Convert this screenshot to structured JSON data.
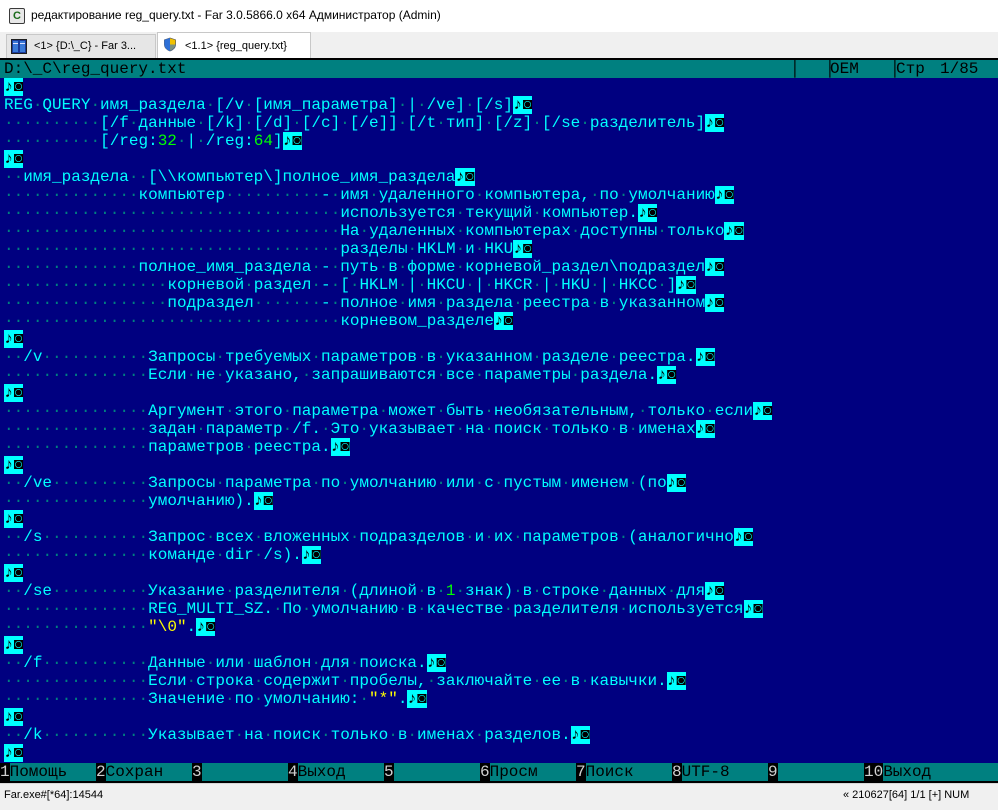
{
  "window": {
    "title": "редактирование reg_query.txt - Far 3.0.5866.0 x64 Администратор (Admin)",
    "icon": "far-manager-icon"
  },
  "tabs": [
    {
      "label": "<1> {D:\\_C} - Far 3...",
      "icon": "far-panels-icon",
      "active": false
    },
    {
      "label": "<1.1> {reg_query.txt}",
      "icon": "shield-icon",
      "active": true
    }
  ],
  "editor": {
    "path": "D:\\_C\\reg_query.txt",
    "codepage": "OEM",
    "mode_label": "Стр",
    "position": "1/85",
    "lines": [
      "",
      "REG QUERY имя_раздела [/v [имя_параметра] | /ve] [/s]",
      "          [/f данные [/k] [/d] [/c] [/e]] [/t тип] [/z] [/se разделитель]",
      "          [/reg:32 | /reg:64]",
      "",
      "  имя_раздела  [\\\\компьютер\\]полное_имя_раздела",
      "              компьютер          - имя удаленного компьютера, по умолчанию",
      "                                   используется текущий компьютер.",
      "                                   На удаленных компьютерах доступны только",
      "                                   разделы HKLM и HKU",
      "              полное_имя_раздела - путь в форме корневой_раздел\\подраздел",
      "                 корневой раздел - [ HKLM | HKCU | HKCR | HKU | HKCC ]",
      "                 подраздел       - полное имя раздела реестра в указанном",
      "                                   корневом_разделе",
      "",
      "  /v           Запросы требуемых параметров в указанном разделе реестра.",
      "               Если не указано, запрашиваются все параметры раздела.",
      "",
      "               Аргумент этого параметра может быть необязательным, только если",
      "               задан параметр /f. Это указывает на поиск только в именах",
      "               параметров реестра.",
      "",
      "  /ve          Запросы параметра по умолчанию или с пустым именем (по",
      "               умолчанию).",
      "",
      "  /s           Запрос всех вложенных подразделов и их параметров (аналогично",
      "               команде dir /s).",
      "",
      "  /se          Указание разделителя (длиной в 1 знак) в строке данных для",
      "               REG_MULTI_SZ. По умолчанию в качестве разделителя используется",
      "               \"\\0\".",
      "",
      "  /f           Данные или шаблон для поиска.",
      "               Если строка содержит пробелы, заключайте ее в кавычки.",
      "               Значение по умолчанию: \"*\".",
      "",
      "  /k           Указывает на поиск только в именах разделов.",
      ""
    ]
  },
  "keybar": [
    {
      "num": "1",
      "label": "Помощь"
    },
    {
      "num": "2",
      "label": "Сохран"
    },
    {
      "num": "3",
      "label": ""
    },
    {
      "num": "4",
      "label": "Выход"
    },
    {
      "num": "5",
      "label": ""
    },
    {
      "num": "6",
      "label": "Просм"
    },
    {
      "num": "7",
      "label": "Поиск"
    },
    {
      "num": "8",
      "label": "UTF-8"
    },
    {
      "num": "9",
      "label": ""
    },
    {
      "num": "10",
      "label": "Выход"
    }
  ],
  "statusbar": {
    "left": "Far.exe#[*64]:14544",
    "right": "« 210627[64]   1/1   [+] NUM"
  },
  "colors": {
    "background": "#000080",
    "text": "#00ffff",
    "whitespace": "#008080",
    "number": "#00ff00",
    "string": "#ffff00",
    "bar": "#008080"
  }
}
